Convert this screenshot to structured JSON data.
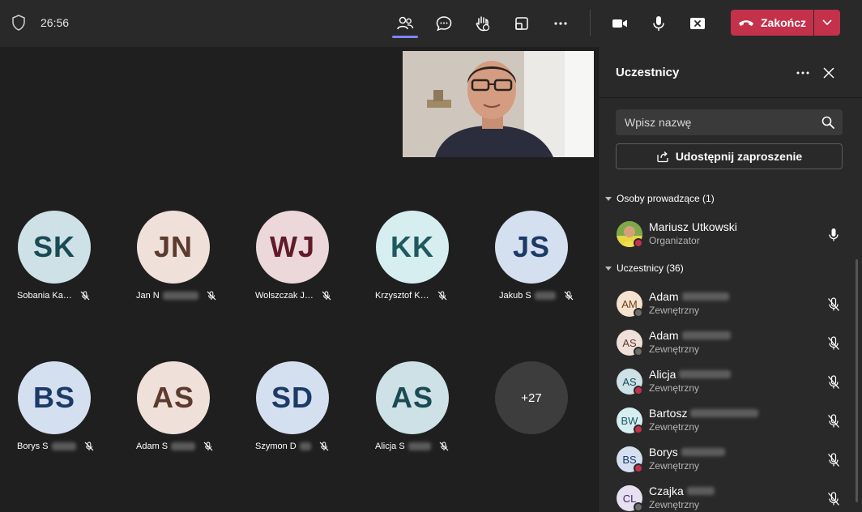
{
  "topbar": {
    "time": "26:56",
    "end_label": "Zakończ",
    "colors": {
      "end": "#c4314b",
      "active_underline": "#7f85f5"
    },
    "icons": [
      "people-icon",
      "chat-icon",
      "raise-hand-icon",
      "share-tray-icon",
      "more-icon",
      "camera-icon",
      "microphone-icon",
      "share-screen-icon"
    ]
  },
  "stage": {
    "tiles_row1": [
      {
        "initials": "SK",
        "name": "Sobania Ka…",
        "bg": "#cde1e6",
        "fg": "#1a4a53"
      },
      {
        "initials": "JN",
        "name": "Jan N",
        "bg": "#f0e0da",
        "fg": "#5c3a2e"
      },
      {
        "initials": "WJ",
        "name": "Wolszczak J…",
        "bg": "#ecd7da",
        "fg": "#5f1c27"
      },
      {
        "initials": "KK",
        "name": "Krzysztof K…",
        "bg": "#d6eef0",
        "fg": "#1d5a5f"
      },
      {
        "initials": "JS",
        "name": "Jakub S",
        "bg": "#d4e0f0",
        "fg": "#1c3a66"
      }
    ],
    "tiles_row2": [
      {
        "initials": "BS",
        "name": "Borys S",
        "bg": "#d4e0f0",
        "fg": "#1c3a66"
      },
      {
        "initials": "AS",
        "name": "Adam S",
        "bg": "#f0e0da",
        "fg": "#5c3a2e"
      },
      {
        "initials": "SD",
        "name": "Szymon D",
        "bg": "#d4e0f0",
        "fg": "#1c3a66"
      },
      {
        "initials": "AS",
        "name": "Alicja S",
        "bg": "#cde1e6",
        "fg": "#1a4a53"
      }
    ],
    "more_count": "+27"
  },
  "panel": {
    "title": "Uczestnicy",
    "search_placeholder": "Wpisz nazwę",
    "share_label": "Udostępnij zaproszenie",
    "presenters_header": "Osoby prowadzące (1)",
    "attendees_header": "Uczestnicy (36)",
    "organizer": {
      "name": "Mariusz Utkowski",
      "role": "Organizator"
    },
    "attendees": [
      {
        "initials": "AM",
        "name": "Adam",
        "sub": "Zewnętrzny",
        "bg": "#f6e3cf",
        "fg": "#6b3e17",
        "status": "#6b6b6b"
      },
      {
        "initials": "AS",
        "name": "Adam",
        "sub": "Zewnętrzny",
        "bg": "#f0e0da",
        "fg": "#5c3a2e",
        "status": "#6b6b6b"
      },
      {
        "initials": "AS",
        "name": "Alicja",
        "sub": "Zewnętrzny",
        "bg": "#cde1e6",
        "fg": "#1a4a53",
        "status": "#c4314b"
      },
      {
        "initials": "BW",
        "name": "Bartosz",
        "sub": "Zewnętrzny",
        "bg": "#d6eef0",
        "fg": "#1d5a5f",
        "status": "#c4314b"
      },
      {
        "initials": "BS",
        "name": "Borys",
        "sub": "Zewnętrzny",
        "bg": "#d4e0f0",
        "fg": "#1c3a66",
        "status": "#c4314b"
      },
      {
        "initials": "CL",
        "name": "Czajka",
        "sub": "Zewnętrzny",
        "bg": "#e6e0f0",
        "fg": "#3b2a66",
        "status": "#6b6b6b"
      }
    ]
  }
}
